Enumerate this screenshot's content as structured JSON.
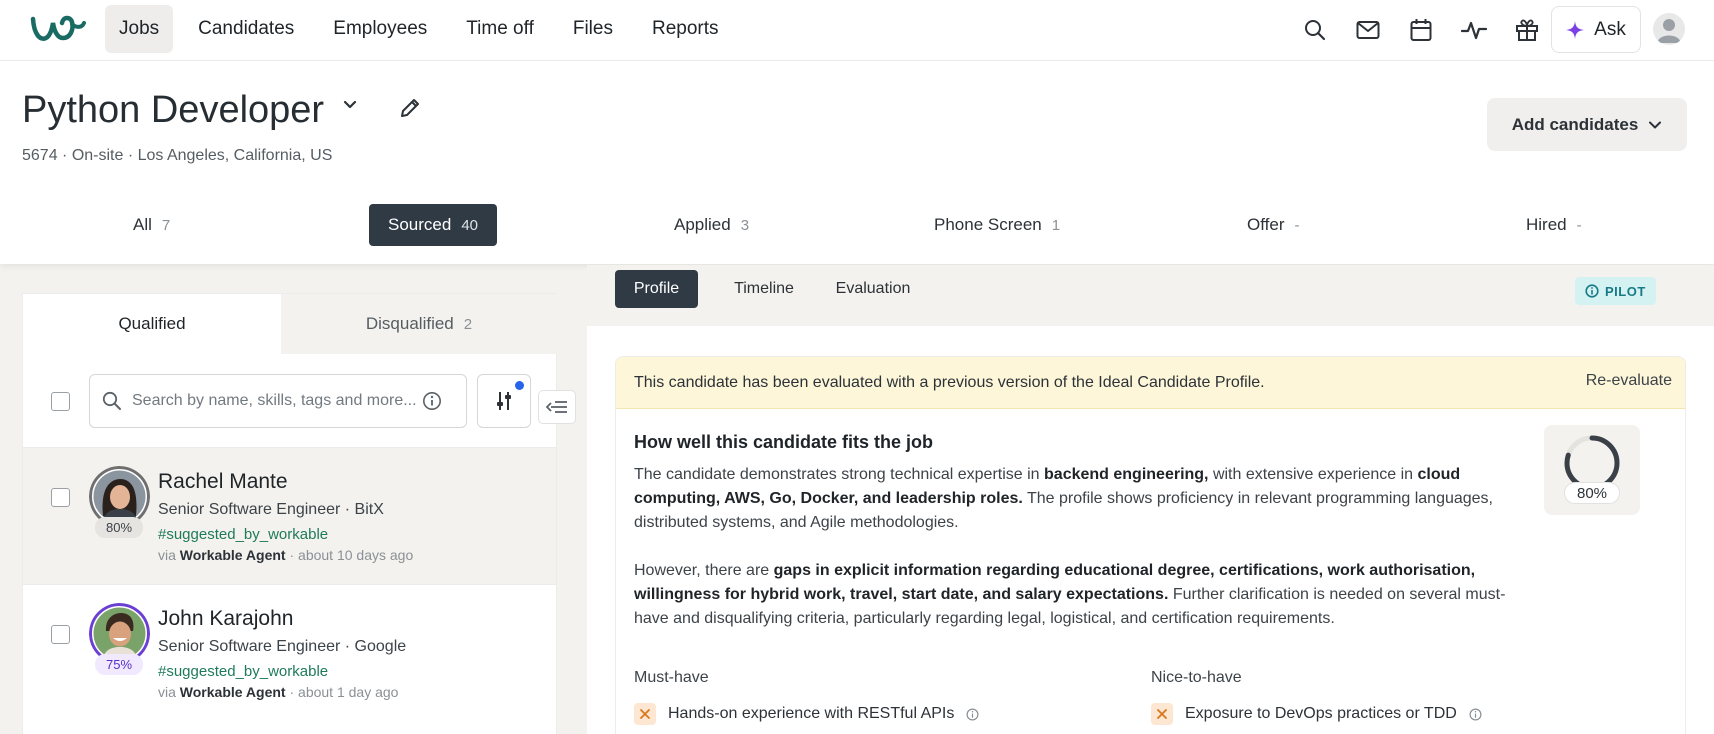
{
  "nav": {
    "logo": "workable-logo",
    "items": [
      {
        "label": "Jobs",
        "active": true
      },
      {
        "label": "Candidates"
      },
      {
        "label": "Employees"
      },
      {
        "label": "Time off"
      },
      {
        "label": "Files"
      },
      {
        "label": "Reports"
      }
    ],
    "icons": [
      "search-icon",
      "mail-icon",
      "calendar-icon",
      "activity-icon",
      "gift-icon"
    ],
    "ask_label": "Ask"
  },
  "job": {
    "title": "Python Developer",
    "meta": "5674 · On-site · Los Angeles, California, US",
    "add_candidates_label": "Add candidates"
  },
  "stages": [
    {
      "label": "All",
      "count": "7"
    },
    {
      "label": "Sourced",
      "count": "40",
      "active": true
    },
    {
      "label": "Applied",
      "count": "3"
    },
    {
      "label": "Phone Screen",
      "count": "1"
    },
    {
      "label": "Offer",
      "count": "-"
    },
    {
      "label": "Hired",
      "count": "-"
    }
  ],
  "left_panel": {
    "tabs": {
      "qualified": "Qualified",
      "disqualified": "Disqualified",
      "disqualified_count": "2"
    },
    "search_placeholder": "Search by name, skills, tags and more...",
    "candidates": [
      {
        "name": "Rachel Mante",
        "role": "Senior Software Engineer · BitX",
        "tag": "#suggested_by_workable",
        "via_prefix": "via",
        "via_source": "Workable Agent",
        "time": "· about 10 days ago",
        "score": "80%",
        "selected": true
      },
      {
        "name": "John Karajohn",
        "role": "Senior Software Engineer · Google",
        "tag": "#suggested_by_workable",
        "via_prefix": "via",
        "via_source": "Workable Agent",
        "time": "· about 1 day ago",
        "score": "75%",
        "selected": false
      }
    ]
  },
  "right_panel": {
    "tabs": [
      "Profile",
      "Timeline",
      "Evaluation"
    ],
    "active_tab": "Profile",
    "badge": "PILOT",
    "notice": "This candidate has been evaluated with a previous version of the Ideal Candidate Profile.",
    "reevaluate": "Re-evaluate",
    "fit_title": "How well this candidate fits the job",
    "fit_score": "80%",
    "fit_score_value": 0.8,
    "para1": {
      "t1": "The candidate demonstrates strong technical expertise in ",
      "b1": "backend engineering,",
      "t2": " with extensive experience in ",
      "b2": "cloud computing, AWS, Go, Docker, and leadership roles.",
      "t3": " The profile shows proficiency in relevant programming languages, distributed systems, and Agile methodologies."
    },
    "para2": {
      "t1": "However, there are ",
      "b1": "gaps in explicit information regarding educational degree, certifications, work authorisation, willingness for hybrid work, travel, start date, and salary expectations.",
      "t2": " Further clarification is needed on several must-have and disqualifying criteria, particularly regarding legal, logistical, and certification requirements."
    },
    "must_have_title": "Must-have",
    "nice_to_have_title": "Nice-to-have",
    "must_have": [
      "Hands-on experience with RESTful APIs"
    ],
    "nice_to_have": [
      "Exposure to DevOps practices or TDD"
    ]
  },
  "colors": {
    "brand": "#1a6b63",
    "active_dark": "#2f3a45",
    "tag_green": "#1f7a5c",
    "pilot_bg": "#d5f2f2",
    "notice_bg": "#fdf6d8",
    "score_ring_purple": "#6b3fd4"
  }
}
